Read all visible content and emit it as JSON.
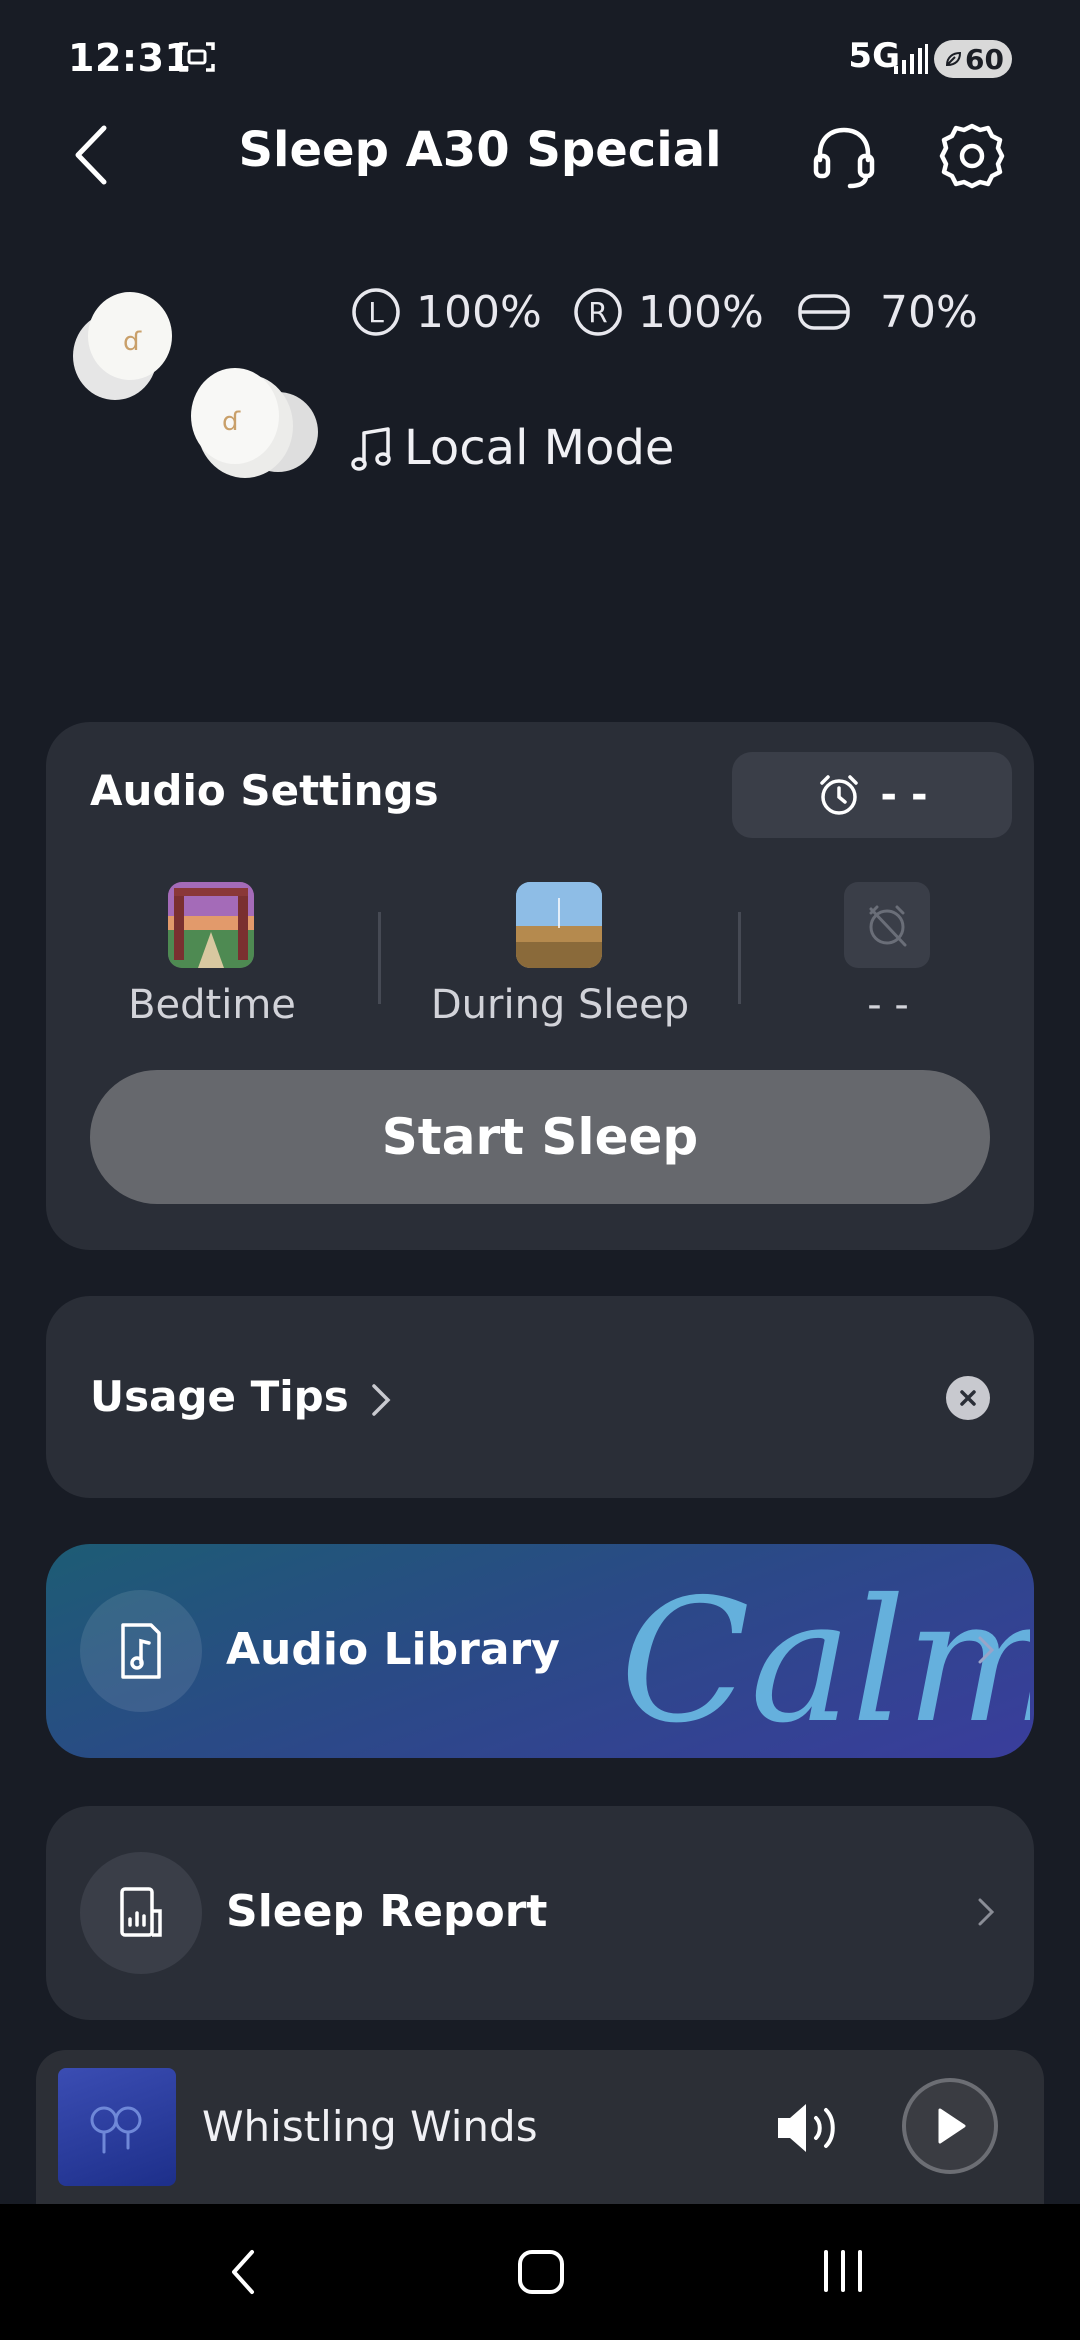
{
  "status_bar": {
    "time": "12:31",
    "network": "5G",
    "battery": "60",
    "icons": [
      "screenshot-icon",
      "signal-icon",
      "battery-icon"
    ]
  },
  "header": {
    "title": "Sleep A30 Special",
    "icons": [
      "back-arrow-icon",
      "headset-support-icon",
      "gear-icon"
    ]
  },
  "device": {
    "left_label": "L",
    "left_battery": "100%",
    "right_label": "R",
    "right_battery": "100%",
    "case_battery": "70%",
    "mode": "Local Mode",
    "mode_icon": "music-note-icon"
  },
  "audio_settings": {
    "title": "Audio Settings",
    "alarm_value": "- -",
    "sounds": [
      {
        "label": "Bedtime"
      },
      {
        "label": "During Sleep"
      },
      {
        "label": "- -"
      }
    ],
    "start_button": "Start Sleep"
  },
  "usage_tips": {
    "label": "Usage Tips"
  },
  "audio_library": {
    "label": "Audio Library",
    "brand": "Calm"
  },
  "sleep_report": {
    "label": "Sleep Report"
  },
  "player": {
    "track": "Whistling Winds"
  },
  "colors": {
    "background": "#181c25",
    "card": "#2a2e37",
    "start_button": "#66686d",
    "library_gradient_start": "#1d5c74",
    "library_gradient_end": "#3a3d9c",
    "calm_accent": "#6ec3ea"
  }
}
